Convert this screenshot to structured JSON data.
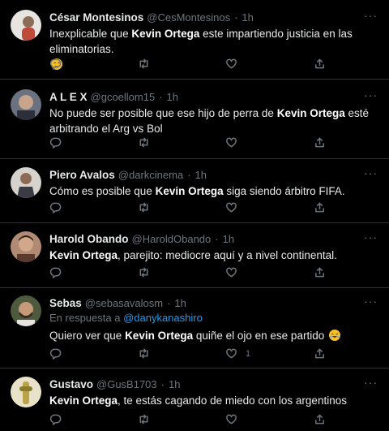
{
  "tweets": [
    {
      "name": "César Montesinos",
      "handle": "@CesMontesinos",
      "sep": "·",
      "time": "1h",
      "text_before": "Inexplicable que ",
      "text_bold": "Kevin Ortega",
      "text_after": " este impartiendo justicia en las eliminatorias.",
      "emoji": "unamused-face-emoji",
      "avatar_color": "#8a6e58"
    },
    {
      "name": "A L E X",
      "handle": "@gcoellom15",
      "sep": "·",
      "time": "1h",
      "text_before": "No puede ser posible que ese hijo de perra de ",
      "text_bold": "Kevin Ortega",
      "text_after": " esté arbitrando el Arg vs Bol",
      "avatar_color": "#4a4f5a"
    },
    {
      "name": "Piero Avalos",
      "handle": "@darkcinema",
      "sep": "·",
      "time": "1h",
      "text_before": "Cómo es posible que ",
      "text_bold": "Kevin Ortega",
      "text_after": " siga siendo árbitro FIFA.",
      "avatar_color": "#c9c3be"
    },
    {
      "name": "Harold Obando",
      "handle": "@HaroldObando",
      "sep": "·",
      "time": "1h",
      "text_before": "",
      "text_bold": "Kevin Ortega",
      "text_after": ", parejito: mediocre aquí y a nivel continental.",
      "avatar_color": "#7a5444"
    },
    {
      "name": "Sebas",
      "handle": "@sebasavalosm",
      "sep": "·",
      "time": "1h",
      "reply_prefix": "En respuesta a ",
      "reply_handle": "@danykanashiro",
      "text_before": "Quiero ver que ",
      "text_bold": "Kevin Ortega",
      "text_after": " quiñe el ojo en ese partido ",
      "emoji": "rofl-emoji",
      "like_count": "1",
      "avatar_color": "#5d6b4a"
    },
    {
      "name": "Gustavo",
      "handle": "@GusB1703",
      "sep": "·",
      "time": "1h",
      "text_before": "",
      "text_bold": "Kevin Ortega",
      "text_after": ", te estás cagando de miedo con los argentinos",
      "avatar_color": "#b9a24a"
    }
  ],
  "icons": {
    "reply": "reply-icon",
    "retweet": "retweet-icon",
    "like": "like-icon",
    "share": "share-icon",
    "more": "more-options-icon"
  },
  "colors": {
    "background": "#000000",
    "link": "#1d9bf0",
    "muted": "#6e767d",
    "divider": "#2f3336"
  }
}
